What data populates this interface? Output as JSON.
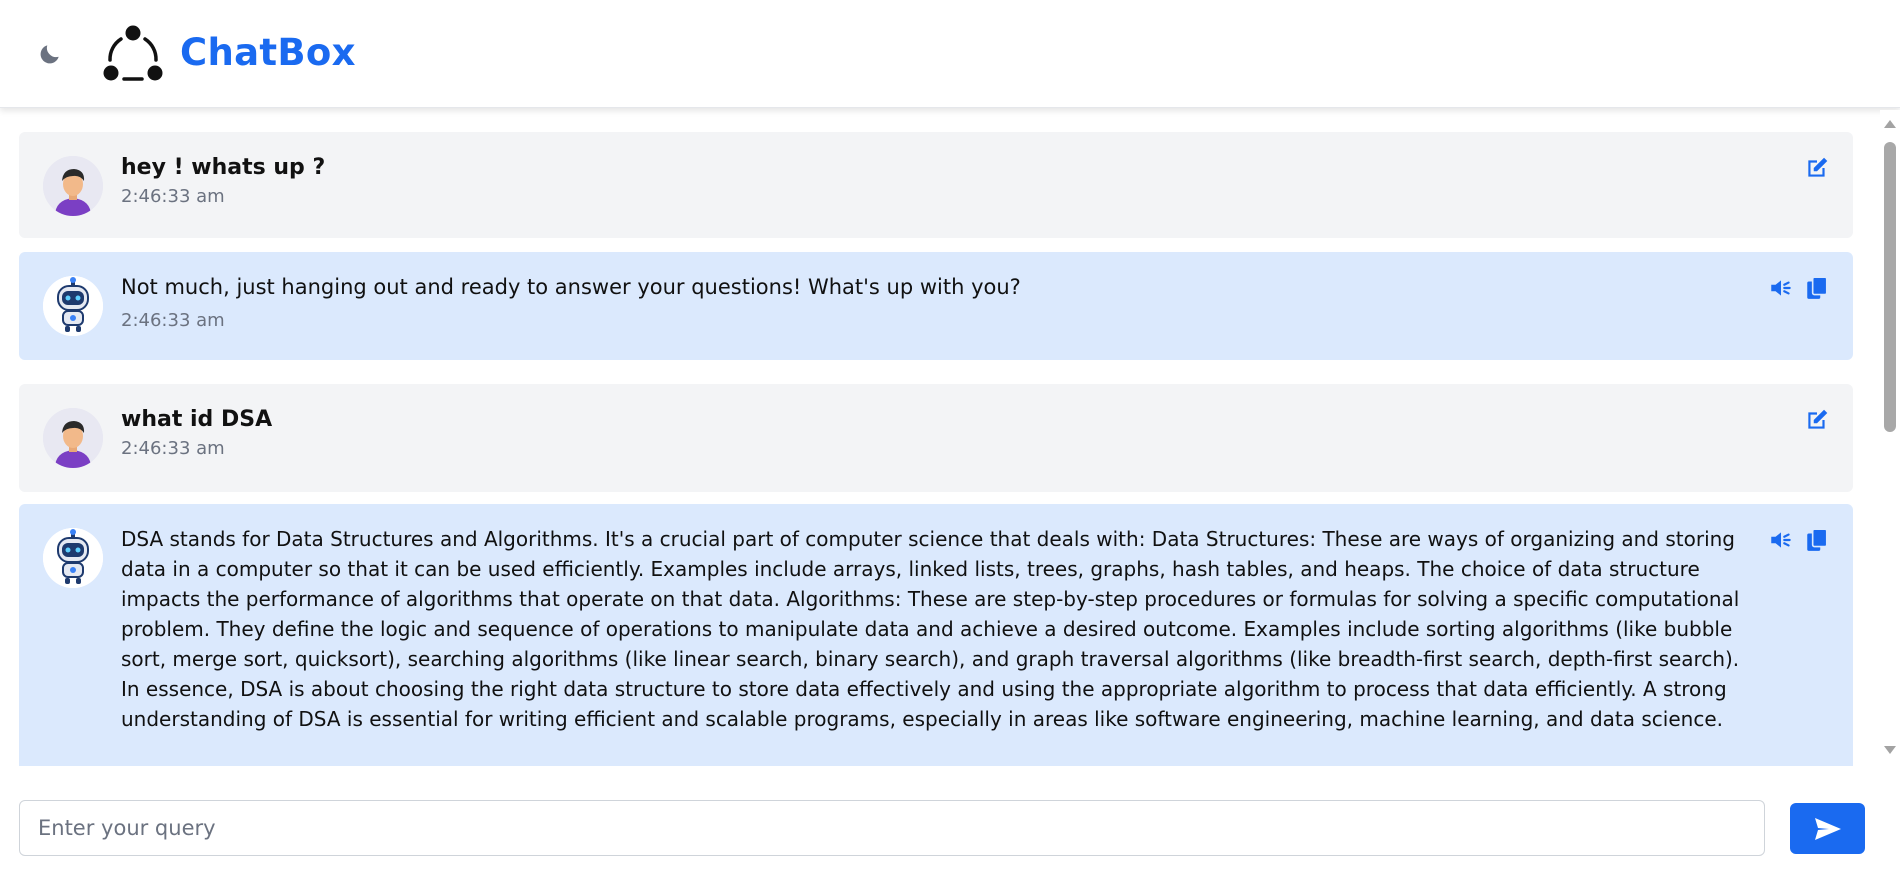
{
  "app": {
    "brand": "ChatBox",
    "accent_color": "#1a6af0",
    "theme_icon": "moon-icon",
    "logo_icon": "connected-nodes-logo"
  },
  "messages": [
    {
      "role": "user",
      "text": "hey ! whats up ?",
      "time": "2:46:33 am",
      "actions": [
        "edit-icon"
      ]
    },
    {
      "role": "bot",
      "text": "Not much, just hanging out and ready to answer your questions! What's up with you?",
      "time": "2:46:33 am",
      "actions": [
        "speaker-icon",
        "copy-icon"
      ]
    },
    {
      "role": "user",
      "text": "what id DSA",
      "time": "2:46:33 am",
      "actions": [
        "edit-icon"
      ]
    },
    {
      "role": "bot",
      "text": "DSA stands for Data Structures and Algorithms. It's a crucial part of computer science that deals with: Data Structures: These are ways of organizing and storing data in a computer so that it can be used efficiently. Examples include arrays, linked lists, trees, graphs, hash tables, and heaps. The choice of data structure impacts the performance of algorithms that operate on that data. Algorithms: These are step-by-step procedures or formulas for solving a specific computational problem. They define the logic and sequence of operations to manipulate data and achieve a desired outcome. Examples include sorting algorithms (like bubble sort, merge sort, quicksort), searching algorithms (like linear search, binary search), and graph traversal algorithms (like breadth-first search, depth-first search). In essence, DSA is about choosing the right data structure to store data effectively and using the appropriate algorithm to process that data efficiently. A strong understanding of DSA is essential for writing efficient and scalable programs, especially in areas like software engineering, machine learning, and data science.",
      "time": "",
      "actions": [
        "speaker-icon",
        "copy-icon"
      ]
    }
  ],
  "composer": {
    "placeholder": "Enter your query",
    "value": "",
    "send_icon": "send-icon"
  }
}
